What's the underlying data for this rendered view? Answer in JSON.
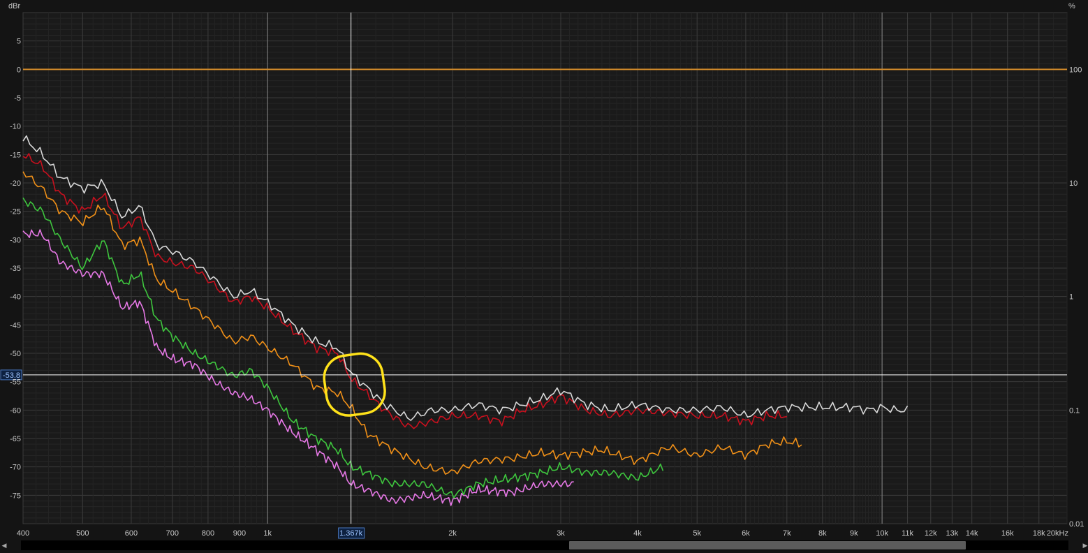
{
  "chart_data": {
    "type": "line",
    "x_scale": "log",
    "xlim": [
      400,
      20000
    ],
    "ylim": [
      -80,
      10
    ],
    "ylabel": "dBr",
    "y2label": "%",
    "xunit": "kHz",
    "grid": true,
    "y_ticks": [
      5,
      0,
      -5,
      -10,
      -15,
      -20,
      -25,
      -30,
      -35,
      -40,
      -45,
      -50,
      -55,
      -60,
      -65,
      -70,
      -75
    ],
    "y_tick_labels": [
      "5",
      "0",
      "-5",
      "-10",
      "-15",
      "-20",
      "-25",
      "-30",
      "-35",
      "-40",
      "-45",
      "-50",
      "-55",
      "-60",
      "-65",
      "-70",
      "-75"
    ],
    "y2_ticks": [
      0,
      -20,
      -40,
      -60,
      -80
    ],
    "y2_tick_labels": [
      "100",
      "10",
      "1",
      "0.1",
      "0.01"
    ],
    "x_ticks": [
      400,
      500,
      600,
      700,
      800,
      900,
      1000,
      2000,
      3000,
      4000,
      5000,
      6000,
      7000,
      8000,
      9000,
      10000,
      11000,
      12000,
      13000,
      14000,
      16000,
      18000
    ],
    "x_tick_labels": [
      "400",
      "500",
      "600",
      "700",
      "800",
      "900",
      "1k",
      "2k",
      "3k",
      "4k",
      "5k",
      "6k",
      "7k",
      "8k",
      "9k",
      "10k",
      "11k",
      "12k",
      "13k",
      "14k",
      "16k",
      "18k"
    ],
    "x_end_label": "20kHz",
    "cursor": {
      "x": 1367,
      "y": -53.8,
      "x_label": "1.367k",
      "y_label": "-53.8"
    },
    "reference_line": {
      "y": 0,
      "color": "#d08a2a"
    },
    "highlight": {
      "x": 1367,
      "y": -55.5,
      "color": "#ffe21a"
    },
    "series": [
      {
        "color": "#d9d9d9",
        "x": [
          400,
          430,
          460,
          500,
          540,
          580,
          620,
          660,
          700,
          760,
          820,
          880,
          940,
          1000,
          1100,
          1200,
          1300,
          1367,
          1450,
          1550,
          1700,
          1850,
          2000,
          2200,
          2400,
          2600,
          2800,
          3000,
          3300,
          3600,
          4000,
          4500,
          5000,
          5500,
          6000,
          6500,
          7000,
          7500,
          8000,
          8500,
          9000,
          9500,
          10000,
          10500,
          11000
        ],
        "y": [
          -12,
          -15,
          -19,
          -21,
          -20,
          -26,
          -24,
          -31,
          -32,
          -34,
          -37,
          -40,
          -39,
          -41,
          -45,
          -48,
          -49,
          -53.5,
          -56,
          -59,
          -61.5,
          -60,
          -60,
          -59,
          -60,
          -59,
          -58,
          -56.5,
          -59,
          -60,
          -59,
          -60,
          -60,
          -59.5,
          -61,
          -60,
          -59.5,
          -59.5,
          -59.5,
          -59.5,
          -59.5,
          -60,
          -59.5,
          -60,
          -60
        ]
      },
      {
        "color": "#c8101e",
        "x": [
          400,
          430,
          460,
          500,
          540,
          580,
          620,
          660,
          700,
          760,
          820,
          880,
          940,
          1000,
          1100,
          1200,
          1300,
          1367,
          1450,
          1550,
          1700,
          1850,
          2000,
          2200,
          2400,
          2600,
          2800,
          3000,
          3300,
          3600,
          4000,
          4500,
          5000,
          5500,
          6000,
          6500,
          7000
        ],
        "y": [
          -15,
          -17,
          -22,
          -25,
          -22,
          -28,
          -26,
          -33,
          -34,
          -35,
          -38,
          -41,
          -40,
          -42,
          -46,
          -49,
          -50,
          -54.5,
          -57,
          -60,
          -63,
          -62,
          -61,
          -61,
          -62,
          -60,
          -59,
          -57.5,
          -60,
          -61,
          -60,
          -60.5,
          -61,
          -61,
          -62,
          -61,
          -61
        ]
      },
      {
        "color": "#f09018",
        "x": [
          400,
          430,
          460,
          500,
          540,
          580,
          620,
          660,
          700,
          760,
          820,
          880,
          940,
          1000,
          1100,
          1200,
          1300,
          1367,
          1450,
          1600,
          1800,
          2000,
          2200,
          2500,
          2800,
          3000,
          3500,
          4000,
          4500,
          5000,
          5500,
          6000,
          6500,
          7000,
          7400
        ],
        "y": [
          -18,
          -21,
          -25,
          -27,
          -24,
          -31,
          -30,
          -37,
          -39,
          -42,
          -45,
          -48,
          -47,
          -49,
          -52,
          -56,
          -57,
          -59.5,
          -64,
          -67,
          -70,
          -71,
          -69,
          -68.5,
          -67.5,
          -68,
          -67,
          -69,
          -66.5,
          -68,
          -66.5,
          -68,
          -66,
          -65.5,
          -66
        ]
      },
      {
        "color": "#3ec63e",
        "x": [
          400,
          430,
          460,
          500,
          540,
          580,
          620,
          660,
          700,
          760,
          820,
          880,
          940,
          1000,
          1100,
          1200,
          1300,
          1367,
          1450,
          1600,
          1800,
          2000,
          2200,
          2500,
          2800,
          3000,
          3300,
          3600,
          4000,
          4400
        ],
        "y": [
          -23,
          -25,
          -30,
          -35,
          -30,
          -38,
          -36,
          -44,
          -47,
          -50,
          -52,
          -54,
          -53,
          -56,
          -62,
          -65,
          -67,
          -70,
          -71,
          -73,
          -73,
          -75,
          -73,
          -72,
          -71,
          -70,
          -71,
          -71,
          -72,
          -70
        ]
      },
      {
        "color": "#e678e6",
        "x": [
          400,
          430,
          460,
          500,
          540,
          580,
          620,
          660,
          700,
          760,
          820,
          880,
          940,
          1000,
          1100,
          1200,
          1300,
          1367,
          1450,
          1600,
          1800,
          2000,
          2200,
          2500,
          2800,
          3000,
          3150
        ],
        "y": [
          -29,
          -29,
          -34,
          -36,
          -36,
          -42,
          -41,
          -49,
          -51,
          -52,
          -55,
          -57,
          -58,
          -60,
          -64,
          -67,
          -70,
          -73,
          -74,
          -76,
          -75,
          -76,
          -74,
          -74.5,
          -73,
          -73,
          -73
        ]
      }
    ]
  }
}
